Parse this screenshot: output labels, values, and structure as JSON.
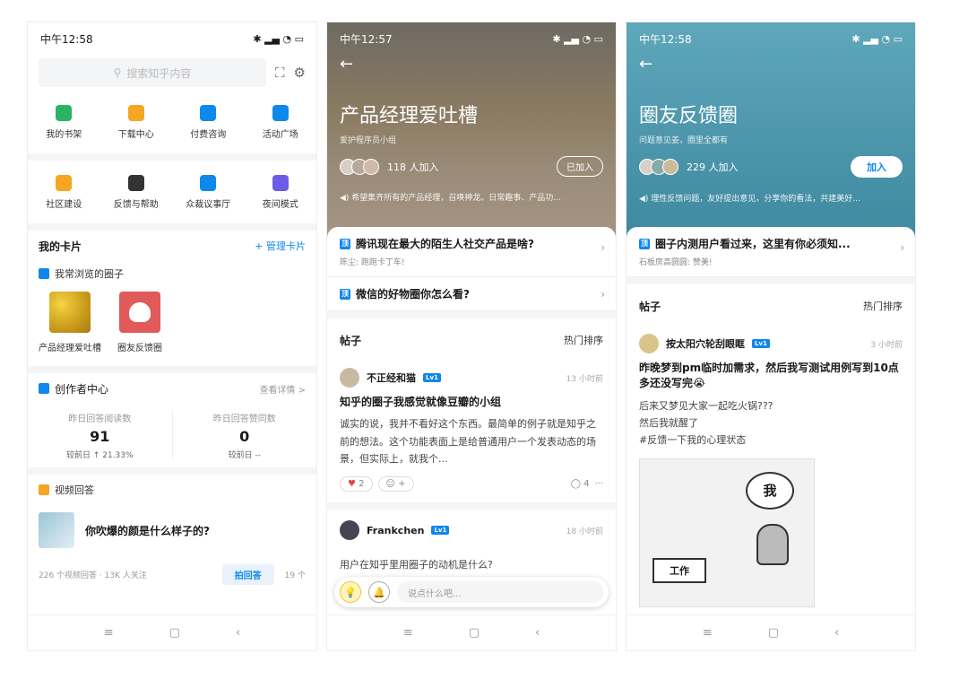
{
  "p1": {
    "status_time": "中午12:58",
    "search_placeholder": "搜索知乎内容",
    "grid1": [
      {
        "label": "我的书架",
        "color": "#28b463"
      },
      {
        "label": "下载中心",
        "color": "#f5a623"
      },
      {
        "label": "付费咨询",
        "color": "#0f88eb"
      },
      {
        "label": "活动广场",
        "color": "#0f88eb"
      }
    ],
    "grid2": [
      {
        "label": "社区建设",
        "color": "#f5a623"
      },
      {
        "label": "反馈与帮助",
        "color": "#333333"
      },
      {
        "label": "众裁议事厅",
        "color": "#0f88eb"
      },
      {
        "label": "夜间模式",
        "color": "#6c5ce7"
      }
    ],
    "cards_title": "我的卡片",
    "manage": "+ 管理卡片",
    "browsed_title": "我常浏览的圈子",
    "circles": [
      "产品经理爱吐槽",
      "圈友反馈圈"
    ],
    "creator_title": "创作者中心",
    "creator_link": "查看详情 >",
    "stat1": {
      "title": "昨日回答阅读数",
      "value": "91",
      "cmp": "较前日 ↑ 21.33%"
    },
    "stat2": {
      "title": "昨日回答赞同数",
      "value": "0",
      "cmp": "较前日 --"
    },
    "video_title": "视频回答",
    "video_q": "你吹爆的颜是什么样子的?",
    "video_meta": "226 个视频回答 · 13K 人关注",
    "video_btn": "拍回答",
    "video_more": "19 个"
  },
  "p2": {
    "status_time": "中午12:57",
    "title": "产品经理爱吐槽",
    "sub": "爱护程序员小组",
    "members": "118 人加入",
    "joined": "已加入",
    "notice": "希望集齐所有的产品经理，召唤神龙。日常趣事、产品功...",
    "top1": "腾讯现在最大的陌生人社交产品是啥?",
    "top1_sub": "陈尘: 跑跑卡丁车!",
    "top2": "微信的好物圈你怎么看?",
    "posts": "帖子",
    "sort": "热门排序",
    "author": "不正经和猫",
    "lv": "Lv1",
    "time": "13 小时前",
    "ptitle": "知乎的圈子我感觉就像豆瓣的小组",
    "pbody": "诚实的说，我并不看好这个东西。最简单的例子就是知乎之前的想法。这个功能表面上是给普通用户一个发表动态的场景，但实际上，就我个...",
    "likes": "2",
    "comments": "4",
    "author2": "Frankchen",
    "time2": "18 小时前",
    "ptitle2": "用户在知乎里用圈子的动机是什么?",
    "comment_ph": "说点什么吧..."
  },
  "p3": {
    "status_time": "中午12:58",
    "title": "圈友反馈圈",
    "sub": "问题意见姜，圈里全都有",
    "members": "229 人加入",
    "join": "加入",
    "notice": "理性反馈问题，友好提出意见，分享你的看法，共建美好...",
    "top1": "圈子内测用户看过来，这里有你必须知...",
    "top1_sub": "石板房高圆圆: 赞美!",
    "posts": "帖子",
    "sort": "热门排序",
    "author": "按太阳穴轮刮眼眶",
    "lv": "Lv1",
    "time": "3 小时前",
    "ptitle": "昨晚梦到pm临时加需求，然后我写测试用例写到10点多还没写完😭",
    "l1": "后来又梦见大家一起吃火锅???",
    "l2": "然后我就醒了",
    "l3": "#反馈一下我的心理状态",
    "bubble": "我",
    "sign": "工作"
  }
}
